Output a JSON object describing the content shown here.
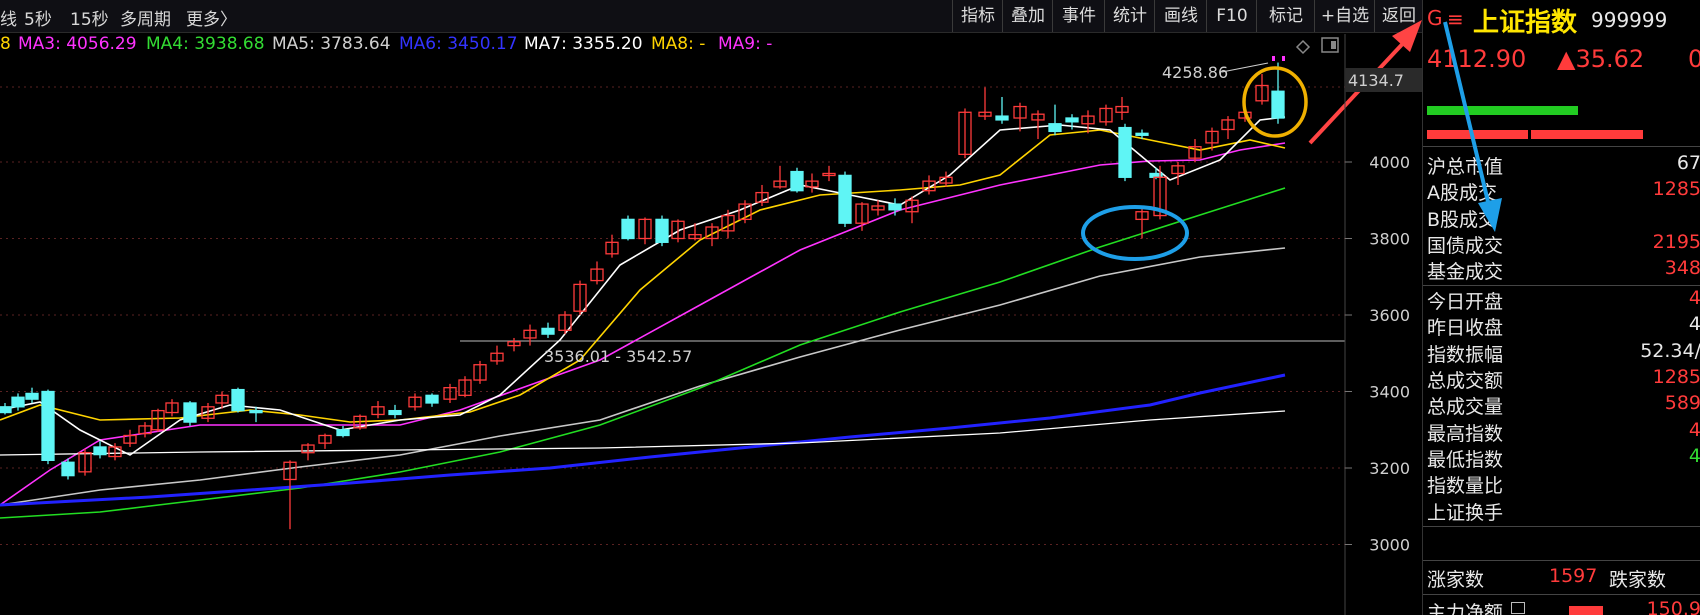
{
  "topbar": {
    "periods": [
      "线",
      "5秒",
      "15秒",
      "多周期",
      "更多〉"
    ],
    "tools": [
      "指标",
      "叠加",
      "事件",
      "统计",
      "画线",
      "F10",
      "标记",
      "+自选",
      "返回"
    ]
  },
  "ma_row": [
    {
      "label": "8",
      "color": "#ffd400"
    },
    {
      "label": "MA3: 4056.29",
      "color": "#ff33ff"
    },
    {
      "label": "MA4: 3938.68",
      "color": "#33dd33"
    },
    {
      "label": "MA5: 3783.64",
      "color": "#d0d0d0"
    },
    {
      "label": "MA6: 3450.17",
      "color": "#3333ff"
    },
    {
      "label": "MA7: 3355.20",
      "color": "#ffffff"
    },
    {
      "label": "MA8: -",
      "color": "#ffd400"
    },
    {
      "label": "MA9: -",
      "color": "#ff33ff"
    }
  ],
  "chart": {
    "y_ticks": [
      4000,
      3800,
      3600,
      3400,
      3200,
      3000
    ],
    "current_price_tag": "4134.7",
    "high_label": "4258.86",
    "range_label": "3536.01 - 3542.57"
  },
  "colors": {
    "up": "#ff3b3b",
    "down": "#5ff5f5",
    "ma_white": "#ffffff",
    "ma_yellow": "#ffd400",
    "ma_magenta": "#ff33ff",
    "ma_green": "#22dd22",
    "ma_gray": "#c8c8c8",
    "ma_blue": "#2222ff",
    "annotation_orange": "#f0b000",
    "annotation_blue": "#1e9fe8",
    "arrow_red": "#ff4444"
  },
  "sidebar": {
    "code_prefix": "G",
    "menu_icon": "menu-icon",
    "name": "上证指数",
    "code": "999999",
    "price": "4112.90",
    "change": "▲35.62",
    "change_pct_partial": "0",
    "rows": [
      {
        "label": "沪总市值",
        "value": "67"
      },
      {
        "label": "A股成交",
        "value": "1285"
      },
      {
        "label": "B股成交",
        "value": ""
      },
      {
        "label": "国债成交",
        "value": "2195"
      },
      {
        "label": "基金成交",
        "value": "348"
      },
      {
        "label": "今日开盘",
        "value": "4"
      },
      {
        "label": "昨日收盘",
        "value": "4"
      },
      {
        "label": "指数振幅",
        "value": "52.34/"
      },
      {
        "label": "总成交额",
        "value": "1285"
      },
      {
        "label": "总成交量",
        "value": "589"
      },
      {
        "label": "最高指数",
        "value": "4"
      },
      {
        "label": "最低指数",
        "value": "4"
      },
      {
        "label": "指数量比",
        "value": ""
      },
      {
        "label": "上证换手",
        "value": ""
      }
    ],
    "rise_label": "涨家数",
    "rise_count": "1597",
    "fall_label": "跌家数",
    "net_flow_label": "主力净额",
    "net_flow_value": "150.9"
  }
}
